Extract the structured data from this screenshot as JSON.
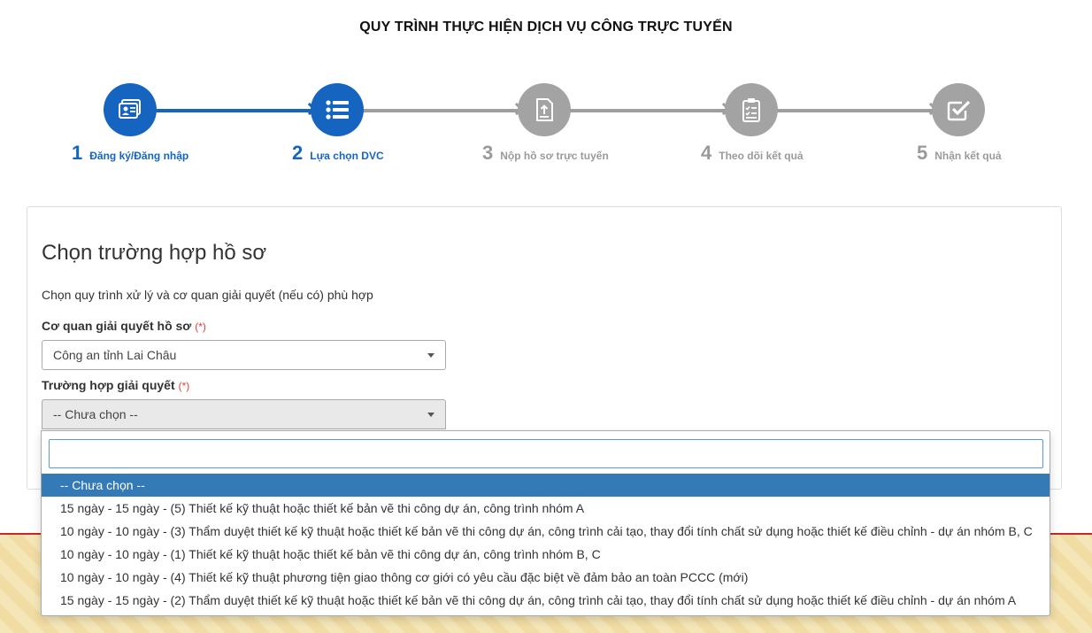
{
  "page": {
    "title": "QUY TRÌNH THỰC HIỆN DỊCH VỤ CÔNG TRỰC TUYẾN"
  },
  "steps": [
    {
      "number": "1",
      "label": "Đăng ký/Đăng nhập",
      "state": "active",
      "icon": "user-card-icon"
    },
    {
      "number": "2",
      "label": "Lựa chọn DVC",
      "state": "active",
      "icon": "list-icon"
    },
    {
      "number": "3",
      "label": "Nộp hồ sơ trực tuyến",
      "state": "inactive",
      "icon": "document-upload-icon"
    },
    {
      "number": "4",
      "label": "Theo dõi kết quả",
      "state": "inactive",
      "icon": "clipboard-checklist-icon"
    },
    {
      "number": "5",
      "label": "Nhận kết quả",
      "state": "inactive",
      "icon": "checkbox-icon"
    }
  ],
  "form": {
    "title": "Chọn trường hợp hồ sơ",
    "description": "Chọn quy trình xử lý và cơ quan giải quyết (nếu có) phù hợp",
    "agency": {
      "label": "Cơ quan giải quyết hồ sơ",
      "required_mark": "(*)",
      "value": "Công an tỉnh Lai Châu"
    },
    "case": {
      "label": "Trường hợp giải quyết",
      "required_mark": "(*)",
      "value": "-- Chưa chọn --"
    }
  },
  "dropdown": {
    "search_value": "",
    "options": [
      {
        "label": "-- Chưa chọn --",
        "selected": true
      },
      {
        "label": "15 ngày - 15 ngày - (5) Thiết kế kỹ thuật hoặc thiết kế bản vẽ thi công dự án, công trình nhóm A",
        "selected": false
      },
      {
        "label": "10 ngày - 10 ngày - (3) Thẩm duyệt thiết kế kỹ thuật hoặc thiết kế bản vẽ thi công dự án, công trình cải tạo, thay đổi tính chất sử dụng hoặc thiết kế điều chỉnh - dự án nhóm B, C",
        "selected": false
      },
      {
        "label": "10 ngày - 10 ngày - (1) Thiết kế kỹ thuật hoặc thiết kế bản vẽ thi công dự án, công trình nhóm B, C",
        "selected": false
      },
      {
        "label": "10 ngày - 10 ngày - (4) Thiết kế kỹ thuật phương tiện giao thông cơ giới có yêu cầu đặc biệt về đảm bảo an toàn PCCC (mới)",
        "selected": false
      },
      {
        "label": "15 ngày - 15 ngày - (2) Thẩm duyệt thiết kế kỹ thuật hoặc thiết kế bản vẽ thi công dự án, công trình cải tạo, thay đổi tính chất sử dụng hoặc thiết kế điều chỉnh - dự án nhóm A",
        "selected": false
      }
    ]
  },
  "colors": {
    "active_step": "#1565c0",
    "inactive_step": "#a3a3a3",
    "selected_option": "#337ab7",
    "required": "#e53935"
  }
}
